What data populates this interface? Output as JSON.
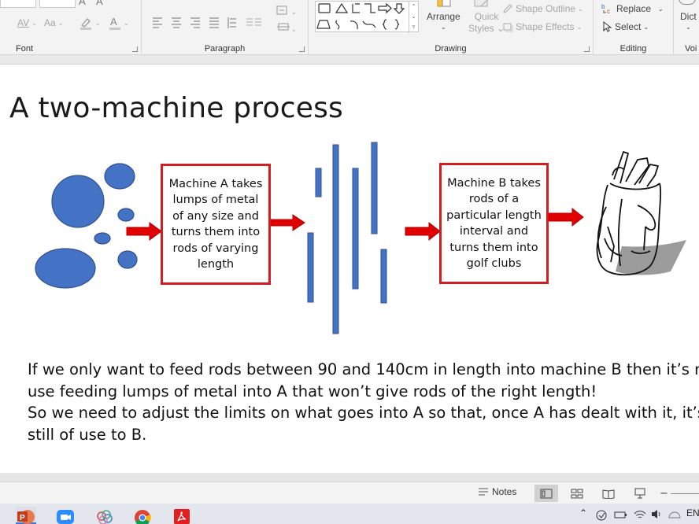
{
  "ribbon": {
    "groups": {
      "font": "Font",
      "paragraph": "Paragraph",
      "drawing": "Drawing",
      "editing": "Editing",
      "voice_partial": "Voi"
    },
    "font_controls": {
      "spacing": "AV",
      "case": "Aa"
    },
    "drawing_buttons": {
      "arrange": "Arrange",
      "quick_styles_line1": "Quick",
      "quick_styles_line2": "Styles",
      "shape_outline": "Shape Outline",
      "shape_effects": "Shape Effects"
    },
    "editing_buttons": {
      "replace": "Replace",
      "select": "Select",
      "dictate_partial": "Dict"
    }
  },
  "slide": {
    "title": "A two-machine process",
    "machine_a": "Machine A takes lumps of metal of any size and turns them into rods of varying length",
    "machine_b": "Machine B takes rods of a particular length interval and turns them into golf clubs",
    "body": {
      "line1": "If we only want to feed rods between 90 and 140cm in length into machine B then it’s no",
      "line2": "use feeding lumps of metal into A that won’t give rods of the right length!",
      "line3": "So we need to adjust the limits on what goes into A so that, once A has dealt with it, it’s",
      "line4": "still of use to B."
    }
  },
  "statusbar": {
    "notes": "Notes"
  },
  "taskbar": {
    "tray_lang": "EN"
  },
  "colors": {
    "shape_blue": "#4472c4",
    "arrow_red": "#e00000",
    "box_border": "#d21e1e",
    "powerpoint": "#c43e1c"
  }
}
